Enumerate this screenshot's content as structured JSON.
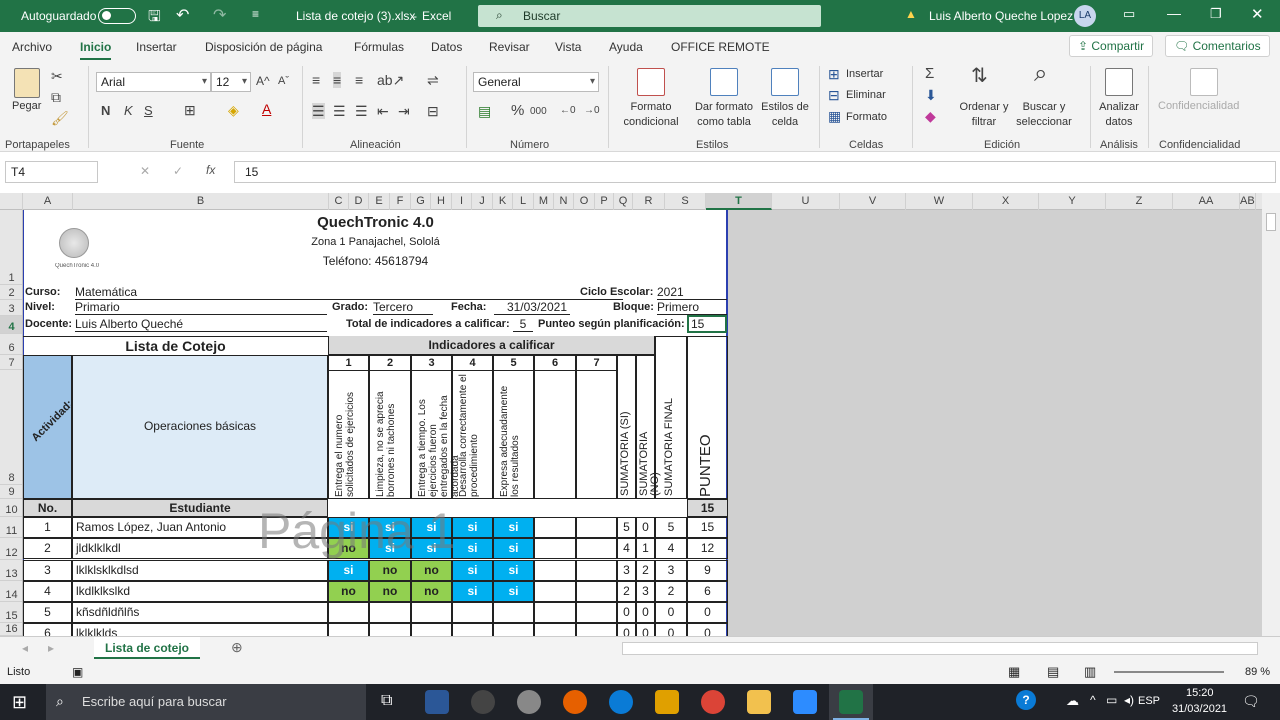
{
  "titlebar": {
    "autosave_label": "Autoguardado",
    "filename": "Lista de cotejo (3).xlsx",
    "app": "Excel",
    "search_label": "Buscar",
    "user": "Luis  Alberto Queche Lopez",
    "initials": "LA"
  },
  "menu": {
    "items": [
      "Archivo",
      "Inicio",
      "Insertar",
      "Disposición de página",
      "Fórmulas",
      "Datos",
      "Revisar",
      "Vista",
      "Ayuda",
      "OFFICE REMOTE"
    ],
    "share": "Compartir",
    "comments": "Comentarios"
  },
  "ribbon": {
    "paste": "Pegar",
    "font_name": "Arial",
    "font_size": "12",
    "number_format": "General",
    "cond_format": "Formato condicional",
    "table_format": "Dar formato como tabla",
    "cell_styles": "Estilos de celda",
    "insert": "Insertar",
    "delete": "Eliminar",
    "format": "Formato",
    "sort_filter": "Ordenar y filtrar",
    "find_select": "Buscar y seleccionar",
    "analyze": "Analizar datos",
    "confidentiality": "Confidencialidad",
    "groups": [
      "Portapapeles",
      "Fuente",
      "Alineación",
      "Número",
      "Estilos",
      "Celdas",
      "Edición",
      "Análisis",
      "Confidencialidad"
    ]
  },
  "formula_bar": {
    "cell_ref": "T4",
    "content": "15"
  },
  "columns": [
    "A",
    "B",
    "C",
    "D",
    "E",
    "F",
    "G",
    "H",
    "I",
    "J",
    "K",
    "L",
    "M",
    "N",
    "O",
    "P",
    "Q",
    "R",
    "S",
    "T",
    "U",
    "V",
    "W",
    "X",
    "Y",
    "Z",
    "AA",
    "AB"
  ],
  "rows": [
    "1",
    "2",
    "3",
    "4",
    "6",
    "7",
    "8",
    "9",
    "10",
    "11",
    "12",
    "13",
    "14",
    "15",
    "16"
  ],
  "sheet": {
    "org": "QuechTronic 4.0",
    "address": "Zona 1 Panajachel, Sololá",
    "phone": "Teléfono: 45618794",
    "logo_caption": "QuechTronic 4.0",
    "curso_label": "Curso:",
    "curso": "Matemática",
    "nivel_label": "Nivel:",
    "nivel": "Primario",
    "docente_label": "Docente:",
    "docente": "Luis Alberto Queché",
    "ciclo_label": "Ciclo Escolar:",
    "ciclo": "2021",
    "grado_label": "Grado:",
    "grado": "Tercero",
    "fecha_label": "Fecha:",
    "fecha": "31/03/2021",
    "bloque_label": "Bloque:",
    "bloque": "Primero",
    "total_label": "Total de indicadores a calificar:",
    "total": "5",
    "punteo_plan_label": "Punteo según planificación:",
    "punteo_plan": "15",
    "list_title": "Lista de Cotejo",
    "indicators_title": "Indicadores a calificar",
    "indicator_numbers": [
      "1",
      "2",
      "3",
      "4",
      "5",
      "6",
      "7"
    ],
    "actividad_label": "Actividad:",
    "actividad": "Operaciones básicas",
    "indicators": [
      "Entrega el numero solicitados de ejercicios",
      "Limpieza, no se aprecia borrones ni tachones",
      "Entrega a tiempo. Los ejercicios fueron entregados en la fecha acordada",
      "Desarrolla correctamente el procedimiento",
      "Expresa adecuadamente los resultados"
    ],
    "sum_si": "SUMATORIA (SI)",
    "sum_no": "SUMATORIA (NO)",
    "sum_final": "SUMATORIA FINAL",
    "punteo_label": "PUNTEO",
    "punteo_max": "15",
    "no_label": "No.",
    "student_label": "Estudiante",
    "students": [
      {
        "no": "1",
        "name": "Ramos López, Juan Antonio",
        "marks": [
          "si",
          "si",
          "si",
          "si",
          "si"
        ],
        "si": "5",
        "nos": "0",
        "final": "5",
        "punteo": "15"
      },
      {
        "no": "2",
        "name": "jldklklkdl",
        "marks": [
          "no",
          "si",
          "si",
          "si",
          "si"
        ],
        "si": "4",
        "nos": "1",
        "final": "4",
        "punteo": "12"
      },
      {
        "no": "3",
        "name": "lklklsklkdlsd",
        "marks": [
          "si",
          "no",
          "no",
          "si",
          "si"
        ],
        "si": "3",
        "nos": "2",
        "final": "3",
        "punteo": "9"
      },
      {
        "no": "4",
        "name": "lkdlklkslkd",
        "marks": [
          "no",
          "no",
          "no",
          "si",
          "si"
        ],
        "si": "2",
        "nos": "3",
        "final": "2",
        "punteo": "6"
      },
      {
        "no": "5",
        "name": "kñsdñldñlñs",
        "marks": [
          "",
          "",
          "",
          "",
          ""
        ],
        "si": "0",
        "nos": "0",
        "final": "0",
        "punteo": "0"
      },
      {
        "no": "6",
        "name": "lklklklds",
        "marks": [
          "",
          "",
          "",
          "",
          ""
        ],
        "si": "0",
        "nos": "0",
        "final": "0",
        "punteo": "0"
      }
    ],
    "watermark": "Página 1"
  },
  "sheet_tab": "Lista de cotejo",
  "status": {
    "ready": "Listo",
    "zoom": "89 %"
  },
  "taskbar": {
    "search": "Escribe aquí para buscar",
    "lang": "ESP",
    "time": "15:20",
    "date": "31/03/2021"
  },
  "colors": {
    "excel_green": "#217346",
    "si_blue": "#00b0f0",
    "no_green": "#92d050"
  }
}
